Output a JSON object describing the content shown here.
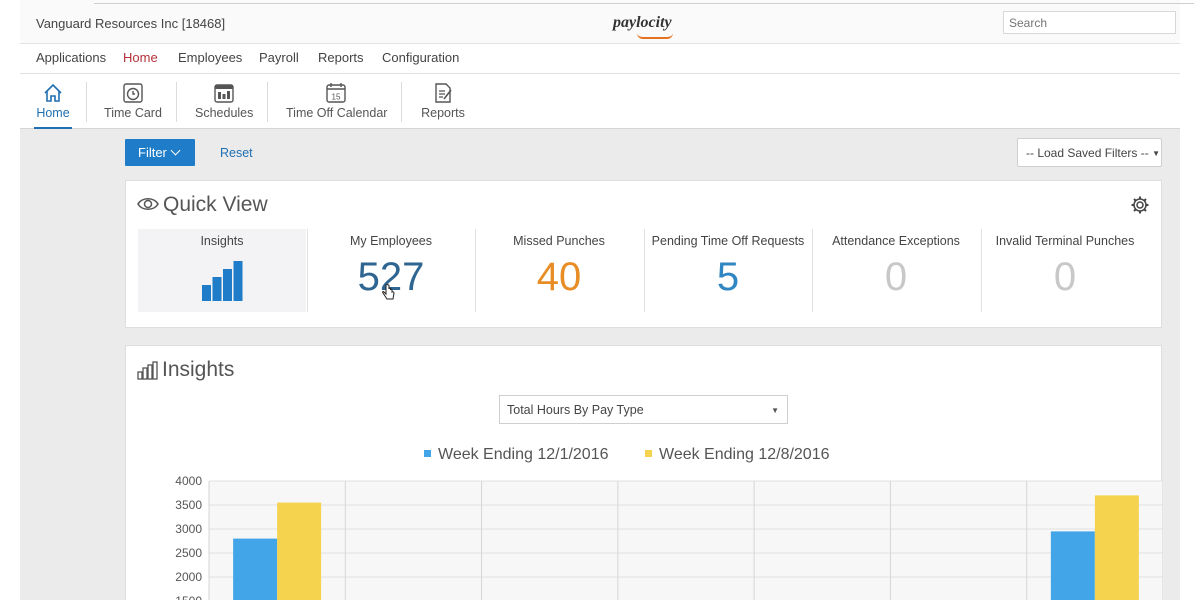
{
  "topbar": {
    "company": "Vanguard Resources Inc [18468]",
    "logo": "paylocity",
    "search_placeholder": "Search"
  },
  "mainnav": [
    "Applications",
    "Home",
    "Employees",
    "Payroll",
    "Reports",
    "Configuration"
  ],
  "subnav": [
    {
      "label": "Home",
      "icon": "home-icon"
    },
    {
      "label": "Time Card",
      "icon": "clock-icon"
    },
    {
      "label": "Schedules",
      "icon": "schedule-icon"
    },
    {
      "label": "Time Off Calendar",
      "icon": "calendar-icon"
    },
    {
      "label": "Reports",
      "icon": "report-icon"
    }
  ],
  "toolbar": {
    "filter": "Filter",
    "reset": "Reset",
    "saved_filters": "-- Load Saved Filters --"
  },
  "quick_view": {
    "title": "Quick View",
    "tiles": [
      {
        "label": "Insights",
        "value": ""
      },
      {
        "label": "My Employees",
        "value": "527",
        "color": "#2f6591"
      },
      {
        "label": "Missed Punches",
        "value": "40",
        "color": "#e88d25"
      },
      {
        "label": "Pending Time Off Requests",
        "value": "5",
        "color": "#2f86c2"
      },
      {
        "label": "Attendance Exceptions",
        "value": "0",
        "color": "#c8c8c8"
      },
      {
        "label": "Invalid Terminal Punches",
        "value": "0",
        "color": "#c8c8c8"
      }
    ]
  },
  "insights": {
    "title": "Insights",
    "select": "Total Hours By Pay Type",
    "legend": [
      "Week Ending 12/1/2016",
      "Week Ending 12/8/2016"
    ]
  },
  "chart_data": {
    "type": "bar",
    "categories": [
      "",
      "",
      "",
      "",
      "",
      "",
      ""
    ],
    "series": [
      {
        "name": "Week Ending 12/1/2016",
        "color": "#41a5e8",
        "values": [
          2800,
          null,
          null,
          null,
          null,
          null,
          2950
        ]
      },
      {
        "name": "Week Ending 12/8/2016",
        "color": "#f5d34f",
        "values": [
          3550,
          null,
          null,
          null,
          null,
          null,
          3700
        ]
      }
    ],
    "yticks": [
      "4000",
      "3500",
      "3000",
      "2500",
      "2000",
      "1500"
    ],
    "ylim": [
      1500,
      4000
    ],
    "grid": true
  }
}
